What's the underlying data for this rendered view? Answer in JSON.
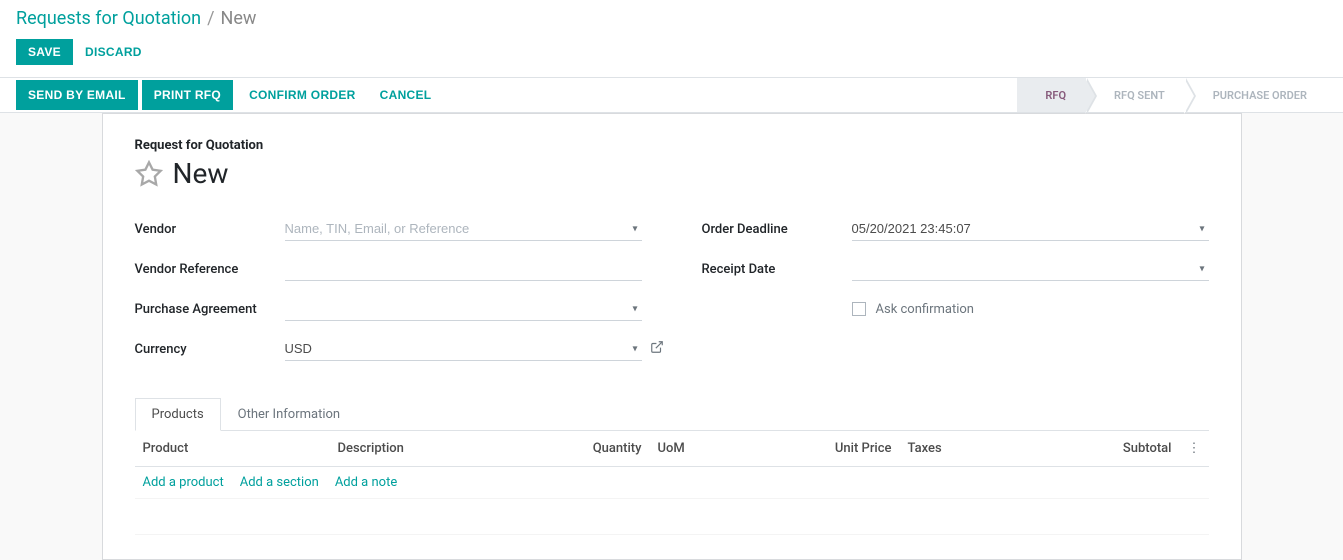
{
  "breadcrumb": {
    "parent": "Requests for Quotation",
    "separator": "/",
    "current": "New"
  },
  "top_buttons": {
    "save": "SAVE",
    "discard": "DISCARD"
  },
  "action_buttons": {
    "send_email": "SEND BY EMAIL",
    "print_rfq": "PRINT RFQ",
    "confirm": "CONFIRM ORDER",
    "cancel": "CANCEL"
  },
  "status_steps": {
    "rfq": "RFQ",
    "rfq_sent": "RFQ SENT",
    "purchase_order": "PURCHASE ORDER"
  },
  "form": {
    "title_label": "Request for Quotation",
    "title": "New",
    "fields": {
      "vendor": {
        "label": "Vendor",
        "placeholder": "Name, TIN, Email, or Reference",
        "value": ""
      },
      "vendor_reference": {
        "label": "Vendor Reference",
        "value": ""
      },
      "purchase_agreement": {
        "label": "Purchase Agreement",
        "value": ""
      },
      "currency": {
        "label": "Currency",
        "value": "USD"
      },
      "order_deadline": {
        "label": "Order Deadline",
        "value": "05/20/2021 23:45:07"
      },
      "receipt_date": {
        "label": "Receipt Date",
        "value": ""
      },
      "ask_confirmation": {
        "label": "Ask confirmation",
        "checked": false
      }
    }
  },
  "tabs": {
    "products": "Products",
    "other_info": "Other Information"
  },
  "table": {
    "headers": {
      "product": "Product",
      "description": "Description",
      "quantity": "Quantity",
      "uom": "UoM",
      "unit_price": "Unit Price",
      "taxes": "Taxes",
      "subtotal": "Subtotal"
    },
    "add_links": {
      "add_product": "Add a product",
      "add_section": "Add a section",
      "add_note": "Add a note"
    }
  }
}
